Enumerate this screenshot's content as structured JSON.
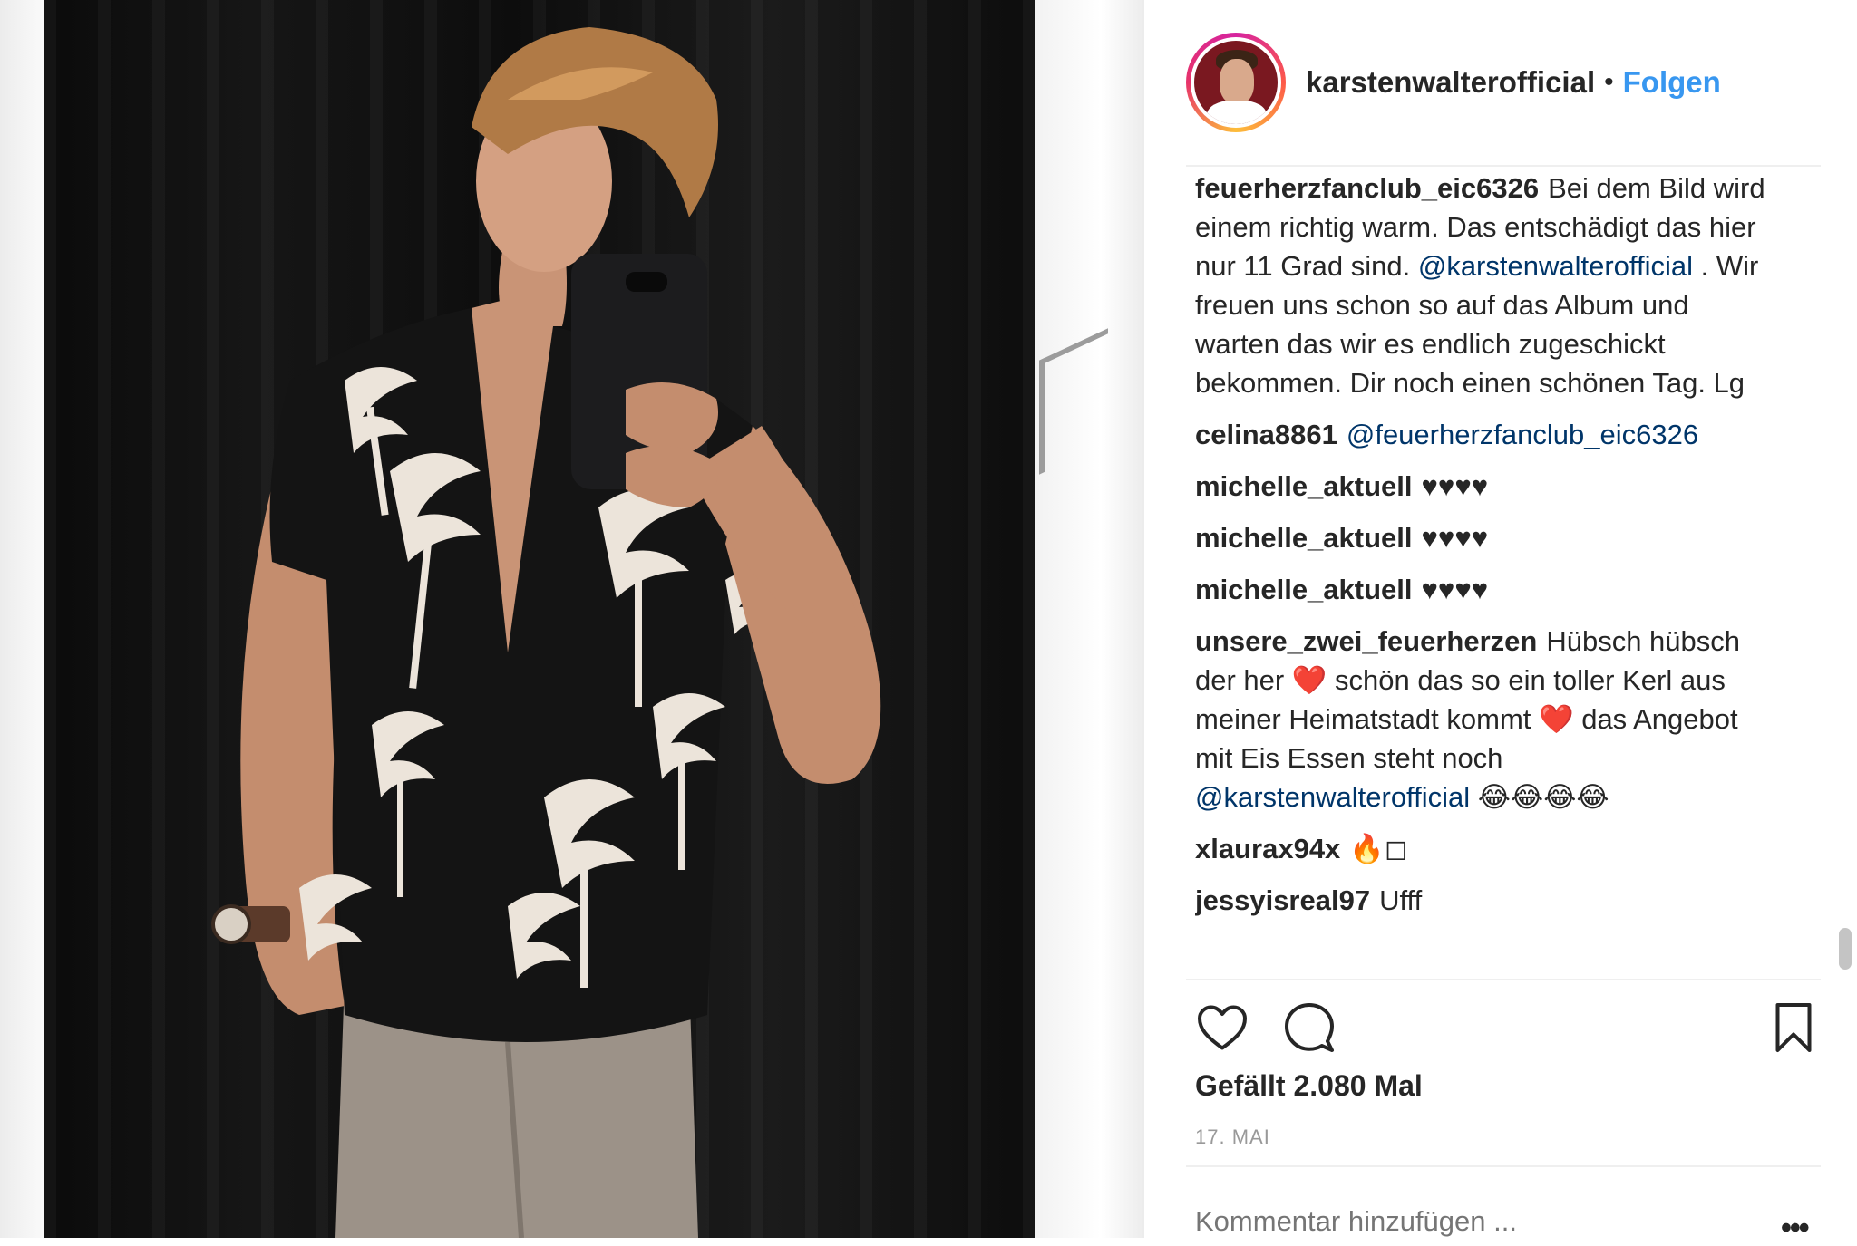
{
  "post": {
    "username": "karstenwalterofficial",
    "separator": "•",
    "follow_label": "Folgen"
  },
  "comments": [
    {
      "user": "feuerherzfanclub_eic6326",
      "text": "Bei dem Bild wird einem richtig warm. Das entschädigt das hier nur 11 Grad sind. ",
      "mention": "@karstenwalterofficial",
      "text_after": " . Wir freuen uns schon so auf das Album und warten das wir es endlich zugeschickt bekommen. Dir noch einen schönen Tag. Lg"
    },
    {
      "user": "celina8861",
      "text": "",
      "mention": "@feuerherzfanclub_eic6326",
      "text_after": ""
    },
    {
      "user": "michelle_aktuell",
      "text": "♥♥♥♥",
      "mention": "",
      "text_after": ""
    },
    {
      "user": "michelle_aktuell",
      "text": "♥♥♥♥",
      "mention": "",
      "text_after": ""
    },
    {
      "user": "michelle_aktuell",
      "text": "♥♥♥♥",
      "mention": "",
      "text_after": ""
    },
    {
      "user": "unsere_zwei_feuerherzen",
      "text": "Hübsch hübsch der her ❤️ schön das so ein toller Kerl aus meiner Heimatstadt kommt ❤️ das Angebot mit Eis Essen steht noch ",
      "mention": "@karstenwalterofficial",
      "text_after": " 😂😂😂😂"
    },
    {
      "user": "xlaurax94x",
      "text": "🔥◻",
      "mention": "",
      "text_after": ""
    },
    {
      "user": "jessyisreal97",
      "text": "Ufff",
      "mention": "",
      "text_after": ""
    }
  ],
  "actions": {
    "like_icon": "heart-icon",
    "comment_icon": "comment-icon",
    "save_icon": "bookmark-icon"
  },
  "likes_text": "Gefällt 2.080 Mal",
  "date_text": "17. MAI",
  "add_comment_placeholder": "Kommentar hinzufügen ...",
  "more_label": "•••",
  "colors": {
    "link": "#3897f0",
    "mention": "#003569",
    "text": "#262626",
    "muted": "#999999"
  }
}
